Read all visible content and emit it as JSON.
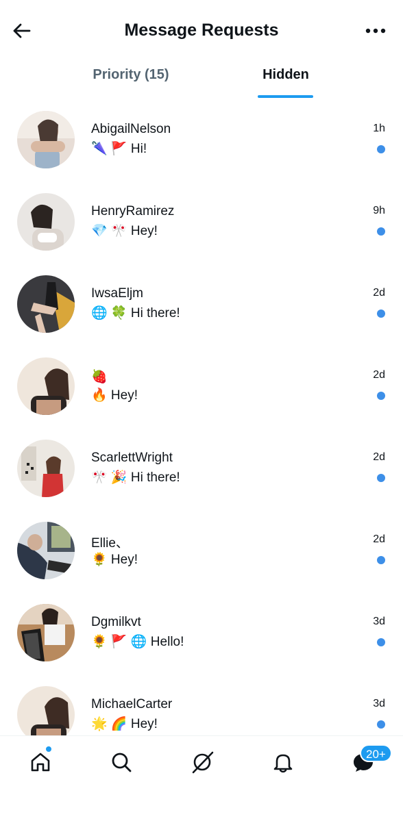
{
  "header": {
    "title": "Message Requests",
    "back_icon": "arrow-left-icon",
    "more_icon": "more-horizontal-icon"
  },
  "tabs": [
    {
      "label": "Priority (15)",
      "active": false
    },
    {
      "label": "Hidden",
      "active": true
    }
  ],
  "conversations": [
    {
      "name": "AbigailNelson",
      "preview": "🌂 🚩 Hi!",
      "time": "1h",
      "unread": true
    },
    {
      "name": "HenryRamirez",
      "preview": "💎 🎌 Hey!",
      "time": "9h",
      "unread": true
    },
    {
      "name": "IwsaEljm",
      "preview": "🌐 🍀 Hi there!",
      "time": "2d",
      "unread": true
    },
    {
      "name": "🍓",
      "preview": "🔥 Hey!",
      "time": "2d",
      "unread": true
    },
    {
      "name": "ScarlettWright",
      "preview": "🎌 🎉 Hi there!",
      "time": "2d",
      "unread": true
    },
    {
      "name": "Ellie、",
      "preview": "🌻 Hey!",
      "time": "2d",
      "unread": true
    },
    {
      "name": "Dgmilkvt",
      "preview": "🌻 🚩 🌐 Hello!",
      "time": "3d",
      "unread": true
    },
    {
      "name": "MichaelCarter",
      "preview": "🌟 🌈 Hey!",
      "time": "3d",
      "unread": true
    }
  ],
  "bottom_nav": {
    "items": [
      "home-icon",
      "search-icon",
      "grok-icon",
      "notifications-icon",
      "messages-icon"
    ],
    "messages_badge": "20+",
    "accent": "#1d9bf0"
  }
}
